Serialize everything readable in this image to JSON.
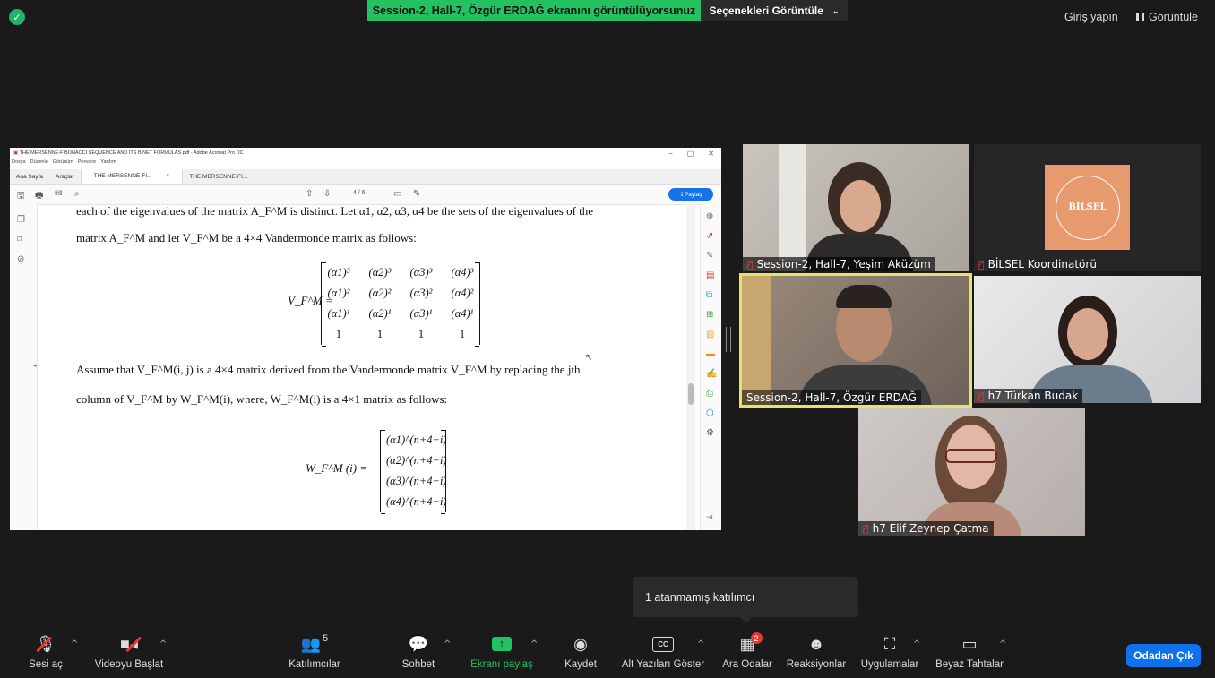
{
  "top": {
    "share_banner": "Session-2, Hall-7, Özgür ERDAĞ ekranını görüntülüyorsunuz",
    "view_options": "Seçenekleri Görüntüle",
    "sign_in": "Giriş yapın",
    "view": "Görüntüle"
  },
  "acrobat": {
    "title": "THE MERSENNE-FIBONACCI SEQUENCE AND ITS BINET FORMULAS.pdf - Adobe Acrobat Pro DC",
    "menu": [
      "Dosya",
      "Düzenle",
      "Görünüm",
      "Pencere",
      "Yardım"
    ],
    "tabs": [
      "Ana Sayfa",
      "Araçlar",
      "THE MERSENNE-FI...",
      "THE MERSENNE-FI..."
    ],
    "page_indicator": "4 / 6",
    "share": "Paylaş"
  },
  "doc": {
    "line1": "each of the eigenvalues of the matrix A_F^M is distinct. Let α1, α2, α3, α4 be the sets of the eigenvalues of the",
    "line2": "matrix A_F^M and let V_F^M be a 4×4 Vandermonde matrix as follows:",
    "v_label": "V_F^M =",
    "v_rows": [
      [
        "(α1)³",
        "(α2)³",
        "(α3)³",
        "(α4)³"
      ],
      [
        "(α1)²",
        "(α2)²",
        "(α3)²",
        "(α4)²"
      ],
      [
        "(α1)¹",
        "(α2)¹",
        "(α3)¹",
        "(α4)¹"
      ],
      [
        "1",
        "1",
        "1",
        "1"
      ]
    ],
    "line3": "Assume that V_F^M(i, j) is a 4×4 matrix derived from the Vandermonde matrix V_F^M by replacing the jth",
    "line4": "column of V_F^M by W_F^M(i), where, W_F^M(i) is a 4×1 matrix as follows:",
    "w_label": "W_F^M (i) =",
    "w_rows": [
      "(α1)^(n+4−i)",
      "(α2)^(n+4−i)",
      "(α3)^(n+4−i)",
      "(α4)^(n+4−i)"
    ]
  },
  "participants": [
    {
      "name": "Session-2, Hall-7, Yeşim Aküzüm"
    },
    {
      "name": "BİLSEL Koordinatörü"
    },
    {
      "name": "Session-2, Hall-7, Özgür ERDAĞ"
    },
    {
      "name": "h7 Türkan Budak"
    },
    {
      "name": "h7 Elif Zeynep Çatma"
    }
  ],
  "bilsel_logo_text": "BİLSEL",
  "popup": "1 atanmamış katılımcı",
  "toolbar": {
    "unmute": "Sesi aç",
    "start_video": "Videoyu Başlat",
    "participants": "Katılımcılar",
    "participants_count": "5",
    "chat": "Sohbet",
    "share_screen": "Ekranı paylaş",
    "record": "Kaydet",
    "captions": "Alt Yazıları Göster",
    "breakout": "Ara Odalar",
    "breakout_badge": "2",
    "reactions": "Reaksiyonlar",
    "apps": "Uygulamalar",
    "whiteboards": "Beyaz Tahtalar",
    "leave": "Odadan Çık"
  },
  "colors": {
    "share_green": "#23c15f",
    "leave_blue": "#0e72ed",
    "active_speaker": "#e7e36a",
    "mute_red": "#e53935"
  }
}
